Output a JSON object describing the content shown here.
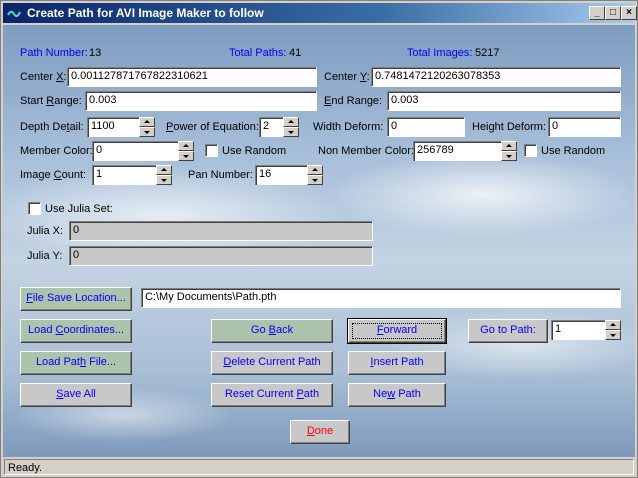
{
  "window": {
    "title": "Create Path for AVI Image Maker to follow",
    "minimize_glyph": "_",
    "maximize_glyph": "□",
    "close_glyph": "×"
  },
  "info": {
    "path_number_label": "Path Number:",
    "path_number": "13",
    "total_paths_label": "Total Paths:",
    "total_paths": "41",
    "total_images_label": "Total Images:",
    "total_images": "5217"
  },
  "form": {
    "center_x_label_pre": "Center ",
    "center_x_label_key": "X",
    "center_x_label_post": ":",
    "center_x": "0.00112787176782231O621",
    "center_y_label_pre": "Center ",
    "center_y_label_key": "Y",
    "center_y_label_post": ":",
    "center_y": "0.7481472120263078353",
    "start_range_label_pre": "Start ",
    "start_range_label_key": "R",
    "start_range_label_post": "ange:",
    "start_range": "0.003",
    "end_range_label_pre": "",
    "end_range_label_key": "E",
    "end_range_label_post": "nd Range:",
    "end_range": "0.003",
    "depth_detail_label_pre": "Depth De",
    "depth_detail_label_key": "t",
    "depth_detail_label_post": "ail:",
    "depth_detail": "1100",
    "power_label_pre": "",
    "power_label_key": "P",
    "power_label_post": "ower of Equation:",
    "power": "2",
    "width_deform_label": "Width Deform:",
    "width_deform": "0",
    "height_deform_label": "Height Deform:",
    "height_deform": "0",
    "member_color_label": "Member Color:",
    "member_color": "0",
    "use_random_label": "Use Random",
    "non_member_color_label": "Non Member Color:",
    "non_member_color": "256789",
    "use_random2_label": "Use Random",
    "image_count_label_pre": "Image ",
    "image_count_label_key": "C",
    "image_count_label_post": "ount:",
    "image_count": "1",
    "pan_number_label": "Pan Number:",
    "pan_number": "16",
    "use_julia_label": "Use Julia Set:",
    "julia_x_label": "Julia X:",
    "julia_x": "0",
    "julia_y_label": "Julia Y:",
    "julia_y": "0",
    "file_path": "C:\\My Documents\\Path.pth",
    "go_to_path_value": "1"
  },
  "buttons": {
    "file_save_location_key": "F",
    "file_save_location_rest": "ile Save Location...",
    "load_coordinates_pre": "Load ",
    "load_coordinates_key": "C",
    "load_coordinates_post": "oordinates...",
    "load_path_file_pre": "Load Pat",
    "load_path_file_key": "h",
    "load_path_file_post": " File...",
    "save_all_key": "S",
    "save_all_rest": "ave All",
    "go_back_pre": "Go ",
    "go_back_key": "B",
    "go_back_post": "ack",
    "delete_current_path_pre": "",
    "delete_current_path_key": "D",
    "delete_current_path_post": "elete Current Path",
    "reset_current_path_pre": "Reset Current ",
    "reset_current_path_key": "P",
    "reset_current_path_post": "ath",
    "forward_key": "F",
    "forward_rest": "orward",
    "insert_path_key": "I",
    "insert_path_rest": "nsert Path",
    "new_path_pre": "Ne",
    "new_path_key": "w",
    "new_path_post": " Path",
    "go_to_path": "Go to Path:",
    "done_key": "D",
    "done_rest": "one"
  },
  "status": {
    "text": "Ready."
  },
  "colors": {
    "label_blue": "#0000ff",
    "button_green": "#aec3ab",
    "done_red": "#ff0000",
    "title_blue": "#0a246a"
  }
}
